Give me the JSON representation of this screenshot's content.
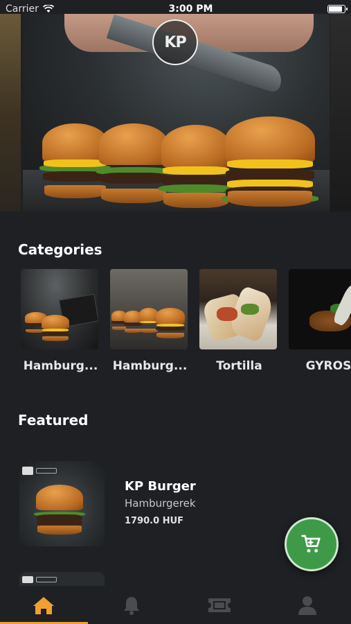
{
  "status_bar": {
    "carrier": "Carrier",
    "time": "3:00 PM"
  },
  "hero": {
    "logo_text": "KP"
  },
  "categories": {
    "title": "Categories",
    "items": [
      {
        "label": "Hamburg..."
      },
      {
        "label": "Hamburg..."
      },
      {
        "label": "Tortilla"
      },
      {
        "label": "GYROS"
      }
    ]
  },
  "featured": {
    "title": "Featured",
    "items": [
      {
        "name": "KP Burger",
        "category": "Hamburgerek",
        "price": "1790.0 HUF"
      }
    ]
  },
  "tabbar": {
    "items": [
      {
        "icon": "home-icon",
        "active": true
      },
      {
        "icon": "bell-icon",
        "active": false
      },
      {
        "icon": "ticket-icon",
        "active": false
      },
      {
        "icon": "user-icon",
        "active": false
      }
    ]
  },
  "colors": {
    "background": "#1f2024",
    "accent": "#f0a030",
    "cart_button": "#3f9a48"
  }
}
